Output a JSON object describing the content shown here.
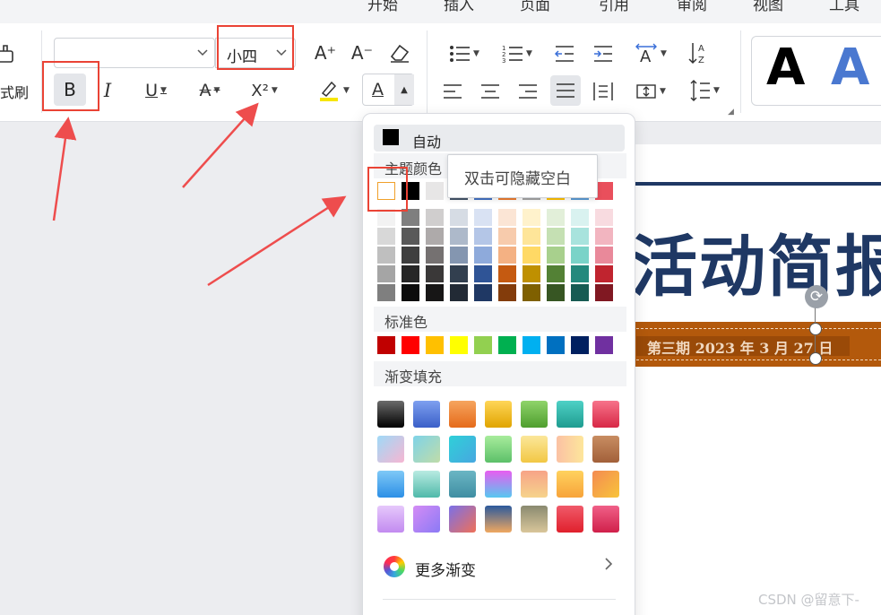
{
  "menu": {
    "tabs": [
      "开始",
      "插入",
      "页面",
      "引用",
      "审阅",
      "视图",
      "工具"
    ]
  },
  "ribbon": {
    "format_painter_label": "式刷",
    "font_name_value": "",
    "font_size_value": "小四",
    "bold_label": "B",
    "italic_label": "I",
    "underline_label": "U",
    "strikethrough_label": "A",
    "superscript_label": "X²",
    "increase_font_label": "A⁺",
    "decrease_font_label": "A⁻",
    "font_color_label": "A",
    "style_preview_labels": [
      "A",
      "A"
    ]
  },
  "color_popup": {
    "auto_label": "自动",
    "theme_label": "主题颜色",
    "standard_label": "标准色",
    "gradient_label": "渐变填充",
    "more_gradient_label": "更多渐变",
    "tooltip": "双击可隐藏空白",
    "theme_top_row": [
      "#ffffff",
      "#000000",
      "#e7e6e6",
      "#44546a",
      "#4472c4",
      "#ed7d31",
      "#a5a5a5",
      "#ffc000",
      "#5b9bd5",
      "#e94f5c"
    ],
    "theme_shades": [
      [
        "#f2f2f2",
        "#7f7f7f",
        "#d0cece",
        "#d6dce4",
        "#d9e2f3",
        "#fbe5d5",
        "#fff2cc",
        "#e2efd9",
        "#d9f2f0",
        "#f8dbe0"
      ],
      [
        "#d8d8d8",
        "#595959",
        "#aeaaaa",
        "#adb9ca",
        "#b4c6e7",
        "#f7cbac",
        "#fee599",
        "#c5e0b3",
        "#a8e3dd",
        "#f2b5c0"
      ],
      [
        "#bfbfbf",
        "#3f3f3f",
        "#757171",
        "#8496b0",
        "#8eaadb",
        "#f4b183",
        "#ffd965",
        "#a8d08d",
        "#7ad3c8",
        "#e9899a"
      ],
      [
        "#a5a5a5",
        "#262626",
        "#3a3838",
        "#323f4f",
        "#2f5496",
        "#c55a11",
        "#bf9000",
        "#538135",
        "#24897d",
        "#c0242f"
      ],
      [
        "#7f7f7f",
        "#0c0c0c",
        "#171616",
        "#222a35",
        "#1f3864",
        "#833c0b",
        "#7f6000",
        "#375623",
        "#175b53",
        "#801822"
      ]
    ],
    "standard_colors": [
      "#c00000",
      "#ff0000",
      "#ffc000",
      "#ffff00",
      "#92d050",
      "#00b050",
      "#00b0f0",
      "#0070c0",
      "#002060",
      "#7030a0"
    ],
    "gradients": [
      [
        "linear-gradient(#6b6b6b,#000000)",
        "linear-gradient(#7ea0f0,#3a5fc8)",
        "linear-gradient(#f6a55e,#e56a1a)",
        "linear-gradient(#ffd658,#e0a400)",
        "linear-gradient(#8fd46a,#4e9e2e)",
        "linear-gradient(#4fd1c6,#1e9c90)",
        "linear-gradient(#f7738a,#d72846)"
      ],
      [
        "linear-gradient(135deg,#9fd9f7,#f7b6d2)",
        "linear-gradient(135deg,#7ed3e8,#c0dca8)",
        "linear-gradient(135deg,#2fd0d8,#47a7e0)",
        "linear-gradient(#a8ec9c,#5cc069)",
        "linear-gradient(#fbe79a,#f2c744)",
        "linear-gradient(90deg,#fbc1a4,#fde69b)",
        "linear-gradient(#c88d62,#a2603a)"
      ],
      [
        "linear-gradient(#7fc9f7,#2c8fe6)",
        "linear-gradient(#b9ebe2,#4fb9a9)",
        "linear-gradient(#6bb6c4,#3f8ea2)",
        "linear-gradient(#e85df0,#57c8f0)",
        "linear-gradient(#f7a388,#f6d38b)",
        "linear-gradient(#ffd25e,#f7a33a)",
        "linear-gradient(135deg,#f48a52,#f8c53a)"
      ],
      [
        "linear-gradient(#e6c8fb,#c28bf0)",
        "linear-gradient(135deg,#d48cf5,#8b7af5)",
        "linear-gradient(135deg,#7a70e8,#ef7058)",
        "linear-gradient(#2c5a9c,#f0a860)",
        "linear-gradient(#8a8a70,#d9c69a)",
        "linear-gradient(#f05a6a,#e0202c)",
        "linear-gradient(#f06088,#d0204a)"
      ]
    ]
  },
  "document": {
    "title_text": "活动简报",
    "date_line": "第三期  2023 年 3 月 27 日"
  },
  "watermark": "CSDN @留意下-"
}
